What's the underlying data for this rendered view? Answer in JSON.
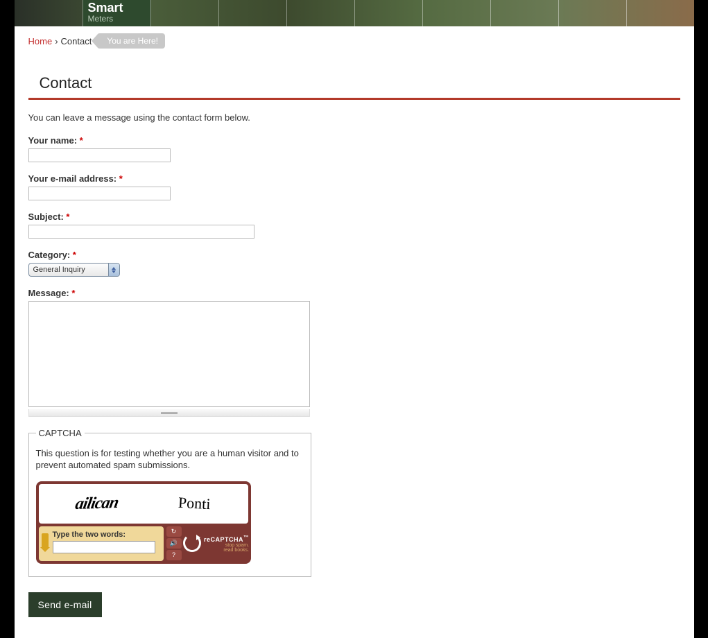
{
  "banner": {
    "title": "Smart",
    "subtitle": "Meters"
  },
  "breadcrumb": {
    "home": "Home",
    "sep": "›",
    "current": "Contact",
    "badge": "You are Here!"
  },
  "page": {
    "title": "Contact",
    "intro": "You can leave a message using the contact form below."
  },
  "form": {
    "name_label": "Your name: ",
    "email_label": "Your e-mail address: ",
    "subject_label": "Subject: ",
    "category_label": "Category: ",
    "category_selected": "General Inquiry",
    "message_label": "Message: ",
    "required_mark": "*",
    "submit_label": "Send e-mail"
  },
  "captcha": {
    "legend": "CAPTCHA",
    "description": "This question is for testing whether you are a human visitor and to prevent automated spam submissions.",
    "word1": "ailican",
    "word2": "Ponti",
    "prompt": "Type the two words:",
    "logo_brand": "reCAPTCHA",
    "logo_tm": "™",
    "tagline1": "stop spam.",
    "tagline2": "read books."
  }
}
